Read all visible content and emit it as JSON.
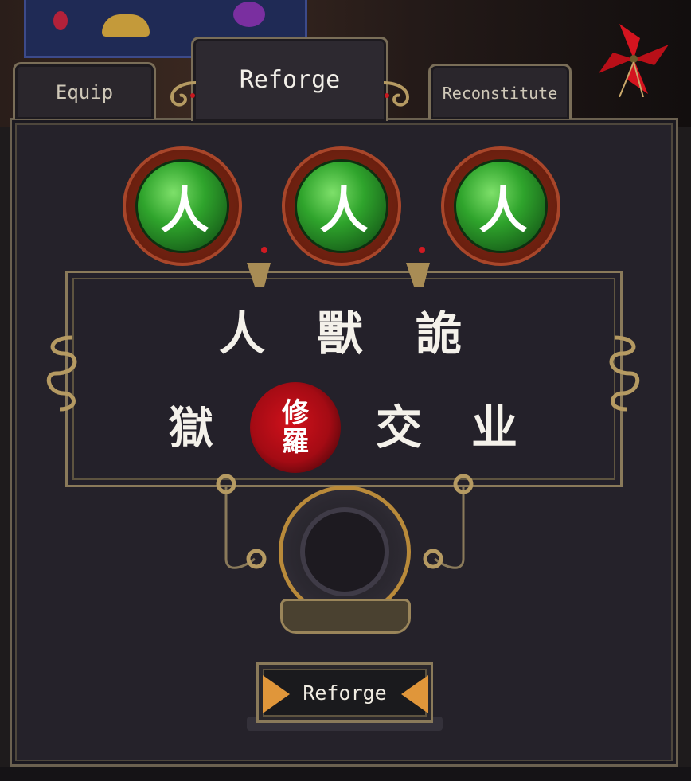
{
  "tabs": [
    {
      "label": "Equip",
      "active": false
    },
    {
      "label": "Reforge",
      "active": true
    },
    {
      "label": "Reconstitute",
      "active": false
    }
  ],
  "gems": [
    {
      "glyph": "人",
      "color": "#2fa42c"
    },
    {
      "glyph": "人",
      "color": "#2fa42c"
    },
    {
      "glyph": "人",
      "color": "#2fa42c"
    }
  ],
  "characters": {
    "row1": [
      "人",
      "獸",
      "詭"
    ],
    "row2": [
      "獄",
      "交",
      "业"
    ],
    "seal": [
      "修",
      "羅"
    ],
    "seal_color": "#c4101a"
  },
  "reforge_button": {
    "label": "Reforge"
  },
  "icons": {
    "close": "pinwheel-icon",
    "arrows": "arrow-icon"
  },
  "colors": {
    "panel": "#25222a",
    "border": "#8a7a5a",
    "accent": "#e0963a"
  }
}
